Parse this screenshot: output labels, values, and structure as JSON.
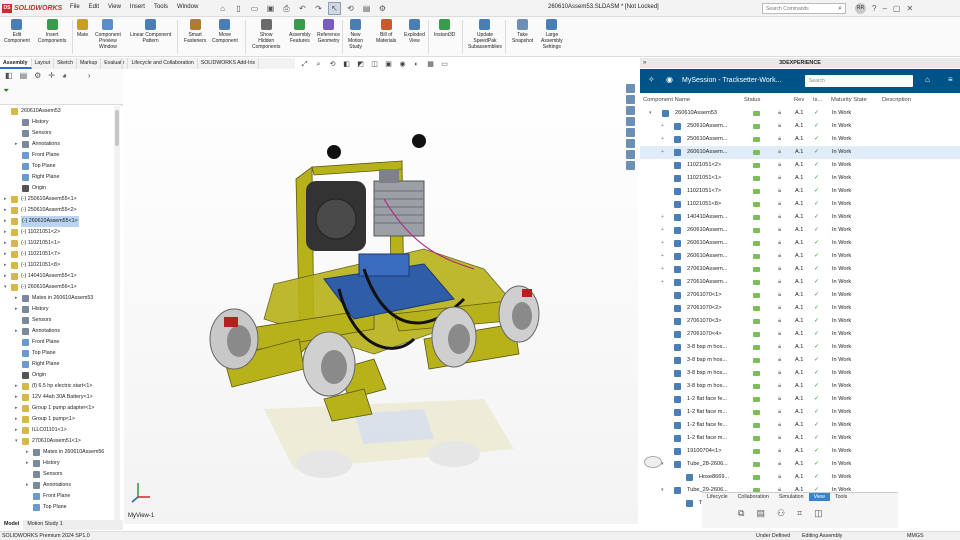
{
  "app": {
    "name": "SOLIDWORKS",
    "doc_title": "260610Assem53.SLDASM * [Not Locked]"
  },
  "menu": [
    "File",
    "Edit",
    "View",
    "Insert",
    "Tools",
    "Window"
  ],
  "search_placeholder": "Search Commands",
  "avatar": "RR",
  "commands": [
    {
      "label": "Edit\nComponent"
    },
    {
      "label": "Insert\nComponents"
    },
    {
      "label": "Mate"
    },
    {
      "label": "Component\nPreview\nWindow"
    },
    {
      "label": "Linear Component\nPattern"
    },
    {
      "label": "Smart\nFasteners"
    },
    {
      "label": "Move\nComponent"
    },
    {
      "label": "Show\nHidden\nComponents"
    },
    {
      "label": "Assembly\nFeatures"
    },
    {
      "label": "Reference\nGeometry"
    },
    {
      "label": "New\nMotion\nStudy"
    },
    {
      "label": "Bill of\nMaterials"
    },
    {
      "label": "Exploded\nView"
    },
    {
      "label": "Instant3D"
    },
    {
      "label": "Update\nSpeedPak\nSubassemblies"
    },
    {
      "label": "Take\nSnapshot"
    },
    {
      "label": "Large\nAssembly\nSettings"
    }
  ],
  "tabs": [
    "Assembly",
    "Layout",
    "Sketch",
    "Markup",
    "Evaluate",
    "Lifecycle and Collaboration",
    "SOLIDWORKS Add-Ins"
  ],
  "tree": [
    {
      "label": "260610Assem53",
      "depth": 0,
      "kind": "asm",
      "exp": ""
    },
    {
      "label": "History",
      "depth": 1,
      "kind": "folder",
      "exp": ""
    },
    {
      "label": "Sensors",
      "depth": 1,
      "kind": "folder",
      "exp": ""
    },
    {
      "label": "Annotations",
      "depth": 1,
      "kind": "folder",
      "exp": "▸"
    },
    {
      "label": "Front Plane",
      "depth": 1,
      "kind": "plane",
      "exp": ""
    },
    {
      "label": "Top Plane",
      "depth": 1,
      "kind": "plane",
      "exp": ""
    },
    {
      "label": "Right Plane",
      "depth": 1,
      "kind": "plane",
      "exp": ""
    },
    {
      "label": "Origin",
      "depth": 1,
      "kind": "origin",
      "exp": ""
    },
    {
      "label": "(-) 250610Assem55<1>",
      "depth": 0,
      "kind": "asm",
      "exp": "▸"
    },
    {
      "label": "(-) 250610Assem55<2>",
      "depth": 0,
      "kind": "asm",
      "exp": "▸"
    },
    {
      "label": "(-) 260610Assem55<1>",
      "depth": 0,
      "kind": "asm",
      "exp": "▸",
      "sel": true
    },
    {
      "label": "(-) 11021051<2>",
      "depth": 0,
      "kind": "part",
      "exp": "▸"
    },
    {
      "label": "(-) 11021051<1>",
      "depth": 0,
      "kind": "part",
      "exp": "▸"
    },
    {
      "label": "(-) 11021051<7>",
      "depth": 0,
      "kind": "part",
      "exp": "▸"
    },
    {
      "label": "(-) 11021051<8>",
      "depth": 0,
      "kind": "part",
      "exp": "▸"
    },
    {
      "label": "(-) 140410Assem55<1>",
      "depth": 0,
      "kind": "asm",
      "exp": "▸"
    },
    {
      "label": "(-) 260610Assem56<1>",
      "depth": 0,
      "kind": "asm",
      "exp": "▾"
    },
    {
      "label": "Mates in 260610Assem53",
      "depth": 1,
      "kind": "folder",
      "exp": "▸"
    },
    {
      "label": "History",
      "depth": 1,
      "kind": "folder",
      "exp": "▸"
    },
    {
      "label": "Sensors",
      "depth": 1,
      "kind": "folder",
      "exp": ""
    },
    {
      "label": "Annotations",
      "depth": 1,
      "kind": "folder",
      "exp": "▸"
    },
    {
      "label": "Front Plane",
      "depth": 1,
      "kind": "plane",
      "exp": ""
    },
    {
      "label": "Top Plane",
      "depth": 1,
      "kind": "plane",
      "exp": ""
    },
    {
      "label": "Right Plane",
      "depth": 1,
      "kind": "plane",
      "exp": ""
    },
    {
      "label": "Origin",
      "depth": 1,
      "kind": "origin",
      "exp": ""
    },
    {
      "label": "(f) 6.5 hp electric start<1>",
      "depth": 1,
      "kind": "part",
      "exp": "▸"
    },
    {
      "label": "12V 44ah 30A Battery<1>",
      "depth": 1,
      "kind": "part",
      "exp": "▸"
    },
    {
      "label": "Group 1 pump adapter<1>",
      "depth": 1,
      "kind": "part",
      "exp": "▸"
    },
    {
      "label": "Group 1 pump<1>",
      "depth": 1,
      "kind": "part",
      "exp": "▸"
    },
    {
      "label": "ILLC01101<1>",
      "depth": 1,
      "kind": "part",
      "exp": "▸"
    },
    {
      "label": "270610Assem51<1>",
      "depth": 1,
      "kind": "asm",
      "exp": "▾"
    },
    {
      "label": "Mates in 260610Assem56",
      "depth": 2,
      "kind": "folder",
      "exp": "▸"
    },
    {
      "label": "History",
      "depth": 2,
      "kind": "folder",
      "exp": "▸"
    },
    {
      "label": "Sensors",
      "depth": 2,
      "kind": "folder",
      "exp": ""
    },
    {
      "label": "Annotations",
      "depth": 2,
      "kind": "folder",
      "exp": "▸"
    },
    {
      "label": "Front Plane",
      "depth": 2,
      "kind": "plane",
      "exp": ""
    },
    {
      "label": "Top Plane",
      "depth": 2,
      "kind": "plane",
      "exp": ""
    }
  ],
  "bottom_tabs": [
    "Model",
    "Motion Study 1"
  ],
  "view_name": "MyView-1",
  "experience": {
    "header": "3DEXPERIENCE",
    "session": "MySession - Tracksetter-Work...",
    "search_placeholder": "Search",
    "columns": [
      "Component Name",
      "Status",
      "Rev",
      "Is...",
      "Maturity State",
      "Description"
    ],
    "rows": [
      {
        "name": "260610Assem53",
        "rev": "A.1",
        "state": "In Work",
        "indent": 0,
        "exp": "▾"
      },
      {
        "name": "250610Assem...",
        "rev": "A.1",
        "state": "In Work",
        "indent": 1,
        "exp": "+"
      },
      {
        "name": "250610Assem...",
        "rev": "A.1",
        "state": "In Work",
        "indent": 1,
        "exp": "+"
      },
      {
        "name": "260610Assem...",
        "rev": "A.1",
        "state": "In Work",
        "indent": 1,
        "exp": "+",
        "hl": true
      },
      {
        "name": "11021051<2>",
        "rev": "A.1",
        "state": "In Work",
        "indent": 1,
        "exp": ""
      },
      {
        "name": "11021051<1>",
        "rev": "A.1",
        "state": "In Work",
        "indent": 1,
        "exp": ""
      },
      {
        "name": "11021051<7>",
        "rev": "A.1",
        "state": "In Work",
        "indent": 1,
        "exp": ""
      },
      {
        "name": "11021051<8>",
        "rev": "A.1",
        "state": "In Work",
        "indent": 1,
        "exp": ""
      },
      {
        "name": "140410Assem...",
        "rev": "A.1",
        "state": "In Work",
        "indent": 1,
        "exp": "+"
      },
      {
        "name": "260610Assem...",
        "rev": "A.1",
        "state": "In Work",
        "indent": 1,
        "exp": "+"
      },
      {
        "name": "260610Assem...",
        "rev": "A.1",
        "state": "In Work",
        "indent": 1,
        "exp": "+"
      },
      {
        "name": "260610Assem...",
        "rev": "A.1",
        "state": "In Work",
        "indent": 1,
        "exp": "+"
      },
      {
        "name": "270610Assem...",
        "rev": "A.1",
        "state": "In Work",
        "indent": 1,
        "exp": "+"
      },
      {
        "name": "270610Assem...",
        "rev": "A.1",
        "state": "In Work",
        "indent": 1,
        "exp": "+"
      },
      {
        "name": "27061070<1>",
        "rev": "A.1",
        "state": "In Work",
        "indent": 1,
        "exp": ""
      },
      {
        "name": "27061070<2>",
        "rev": "A.1",
        "state": "In Work",
        "indent": 1,
        "exp": ""
      },
      {
        "name": "27061070<3>",
        "rev": "A.1",
        "state": "In Work",
        "indent": 1,
        "exp": ""
      },
      {
        "name": "27061070<4>",
        "rev": "A.1",
        "state": "In Work",
        "indent": 1,
        "exp": ""
      },
      {
        "name": "3-8 bsp m hos...",
        "rev": "A.1",
        "state": "In Work",
        "indent": 1,
        "exp": ""
      },
      {
        "name": "3-8 bsp m hos...",
        "rev": "A.1",
        "state": "In Work",
        "indent": 1,
        "exp": ""
      },
      {
        "name": "3-8 bsp m hos...",
        "rev": "A.1",
        "state": "In Work",
        "indent": 1,
        "exp": ""
      },
      {
        "name": "3-8 bsp m hos...",
        "rev": "A.1",
        "state": "In Work",
        "indent": 1,
        "exp": ""
      },
      {
        "name": "1-2 flat face fe...",
        "rev": "A.1",
        "state": "In Work",
        "indent": 1,
        "exp": ""
      },
      {
        "name": "1-2 flat face m...",
        "rev": "A.1",
        "state": "In Work",
        "indent": 1,
        "exp": ""
      },
      {
        "name": "1-2 flat face fe...",
        "rev": "A.1",
        "state": "In Work",
        "indent": 1,
        "exp": ""
      },
      {
        "name": "1-2 flat face m...",
        "rev": "A.1",
        "state": "In Work",
        "indent": 1,
        "exp": ""
      },
      {
        "name": "19100704<1>",
        "rev": "A.1",
        "state": "In Work",
        "indent": 1,
        "exp": ""
      },
      {
        "name": "Tube_28-2606...",
        "rev": "A.1",
        "state": "In Work",
        "indent": 1,
        "exp": "▾"
      },
      {
        "name": "Hose8669...",
        "rev": "A.1",
        "state": "In Work",
        "indent": 2,
        "exp": ""
      },
      {
        "name": "Tube_29-2606...",
        "rev": "A.1",
        "state": "In Work",
        "indent": 1,
        "exp": "▾"
      },
      {
        "name": "Tube...",
        "rev": "A.1",
        "state": "In Work",
        "indent": 2,
        "exp": ""
      }
    ],
    "widget_tabs": [
      "Lifecycle",
      "Collaboration",
      "Simulation",
      "View",
      "Tools"
    ],
    "widget_active": "View"
  },
  "status": {
    "left": "SOLIDWORKS Premium 2024 SP1.0",
    "under": "Under Defined",
    "mode": "Editing Assembly",
    "units": "MMGS"
  },
  "colors": {
    "brand": "#d3272e",
    "exp_blue": "#005386",
    "model_yellow": "#b8b21a",
    "model_blue": "#2f5da8"
  }
}
